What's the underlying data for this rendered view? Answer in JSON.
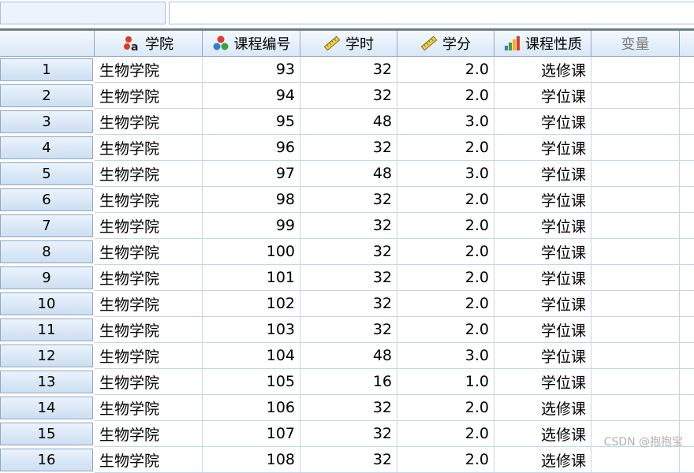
{
  "columns": [
    {
      "label": "学院",
      "icon": "nominal-string-icon",
      "align": "l"
    },
    {
      "label": "课程编号",
      "icon": "nominal-icon",
      "align": "r"
    },
    {
      "label": "学时",
      "icon": "scale-ruler-icon",
      "align": "r"
    },
    {
      "label": "学分",
      "icon": "scale-ruler-icon",
      "align": "r"
    },
    {
      "label": "课程性质",
      "icon": "ordinal-bar-icon",
      "align": "r"
    },
    {
      "label": "变量",
      "icon": "",
      "align": "l"
    }
  ],
  "rows": [
    {
      "n": "1",
      "cells": [
        "生物学院",
        "93",
        "32",
        "2.0",
        "选修课"
      ]
    },
    {
      "n": "2",
      "cells": [
        "生物学院",
        "94",
        "32",
        "2.0",
        "学位课"
      ]
    },
    {
      "n": "3",
      "cells": [
        "生物学院",
        "95",
        "48",
        "3.0",
        "学位课"
      ]
    },
    {
      "n": "4",
      "cells": [
        "生物学院",
        "96",
        "32",
        "2.0",
        "学位课"
      ]
    },
    {
      "n": "5",
      "cells": [
        "生物学院",
        "97",
        "48",
        "3.0",
        "学位课"
      ]
    },
    {
      "n": "6",
      "cells": [
        "生物学院",
        "98",
        "32",
        "2.0",
        "学位课"
      ]
    },
    {
      "n": "7",
      "cells": [
        "生物学院",
        "99",
        "32",
        "2.0",
        "学位课"
      ]
    },
    {
      "n": "8",
      "cells": [
        "生物学院",
        "100",
        "32",
        "2.0",
        "学位课"
      ]
    },
    {
      "n": "9",
      "cells": [
        "生物学院",
        "101",
        "32",
        "2.0",
        "学位课"
      ]
    },
    {
      "n": "10",
      "cells": [
        "生物学院",
        "102",
        "32",
        "2.0",
        "学位课"
      ]
    },
    {
      "n": "11",
      "cells": [
        "生物学院",
        "103",
        "32",
        "2.0",
        "学位课"
      ]
    },
    {
      "n": "12",
      "cells": [
        "生物学院",
        "104",
        "48",
        "3.0",
        "学位课"
      ]
    },
    {
      "n": "13",
      "cells": [
        "生物学院",
        "105",
        "16",
        "1.0",
        "学位课"
      ]
    },
    {
      "n": "14",
      "cells": [
        "生物学院",
        "106",
        "32",
        "2.0",
        "选修课"
      ]
    },
    {
      "n": "15",
      "cells": [
        "生物学院",
        "107",
        "32",
        "2.0",
        "选修课"
      ]
    },
    {
      "n": "16",
      "cells": [
        "生物学院",
        "108",
        "32",
        "2.0",
        "选修课"
      ]
    }
  ],
  "watermark": "CSDN @抱抱宝",
  "colors": {
    "header_bg": "#dce9f7",
    "grid_line": "#c5d6e8",
    "rowhdr_bg": "#d5e5f6"
  }
}
